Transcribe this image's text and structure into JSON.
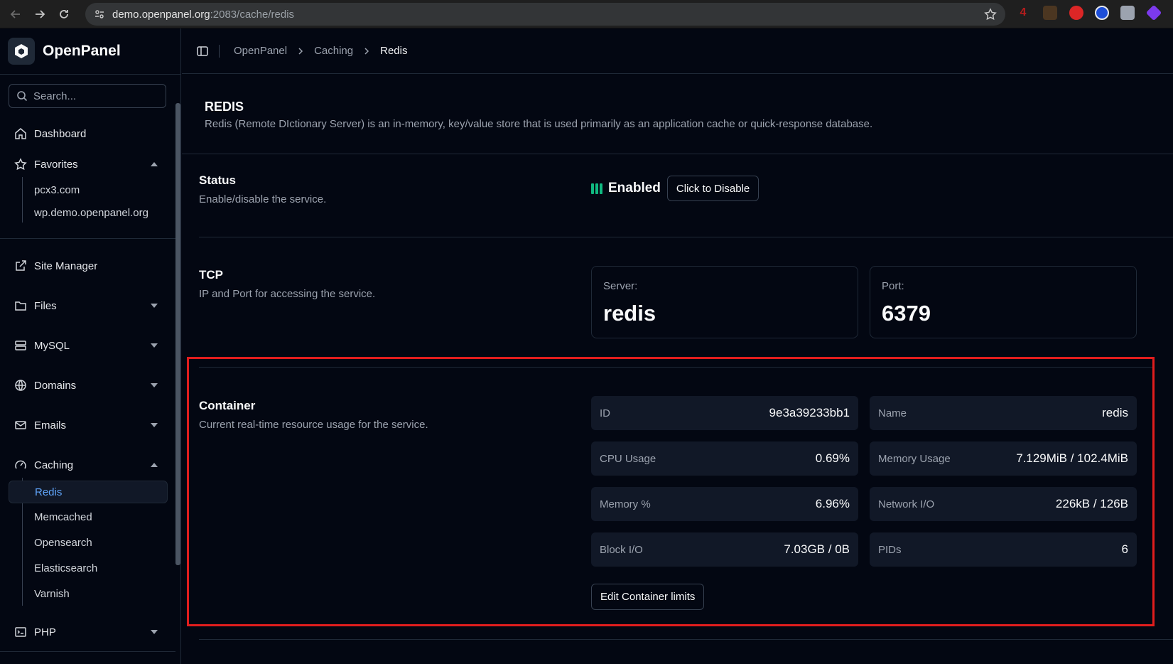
{
  "browser": {
    "url_host": "demo.openpanel.org",
    "url_path": ":2083/cache/redis"
  },
  "brand": {
    "name": "OpenPanel"
  },
  "sidebar": {
    "search_placeholder": "Search...",
    "dashboard": "Dashboard",
    "favorites": {
      "label": "Favorites",
      "items": [
        "pcx3.com",
        "wp.demo.openpanel.org"
      ]
    },
    "site_manager": "Site Manager",
    "files": "Files",
    "mysql": "MySQL",
    "domains": "Domains",
    "emails": "Emails",
    "caching": {
      "label": "Caching",
      "items": [
        "Redis",
        "Memcached",
        "Opensearch",
        "Elasticsearch",
        "Varnish"
      ]
    },
    "php": "PHP"
  },
  "breadcrumb": [
    "OpenPanel",
    "Caching",
    "Redis"
  ],
  "page": {
    "title": "REDIS",
    "description": "Redis (Remote DIctionary Server) is an in-memory, key/value store that is used primarily as an application cache or quick-response database."
  },
  "status": {
    "title": "Status",
    "description": "Enable/disable the service.",
    "state": "Enabled",
    "toggle_label": "Click to Disable",
    "color": "#10b981"
  },
  "tcp": {
    "title": "TCP",
    "description": "IP and Port for accessing the service.",
    "server_label": "Server:",
    "server_value": "redis",
    "port_label": "Port:",
    "port_value": "6379"
  },
  "container": {
    "title": "Container",
    "description": "Current real-time resource usage for the service.",
    "stats": [
      {
        "key": "ID",
        "value": "9e3a39233bb1"
      },
      {
        "key": "Name",
        "value": "redis"
      },
      {
        "key": "CPU Usage",
        "value": "0.69%"
      },
      {
        "key": "Memory Usage",
        "value": "7.129MiB / 102.4MiB"
      },
      {
        "key": "Memory %",
        "value": "6.96%"
      },
      {
        "key": "Network I/O",
        "value": "226kB / 126B"
      },
      {
        "key": "Block I/O",
        "value": "7.03GB / 0B"
      },
      {
        "key": "PIDs",
        "value": "6"
      }
    ],
    "edit_button": "Edit Container limits"
  }
}
